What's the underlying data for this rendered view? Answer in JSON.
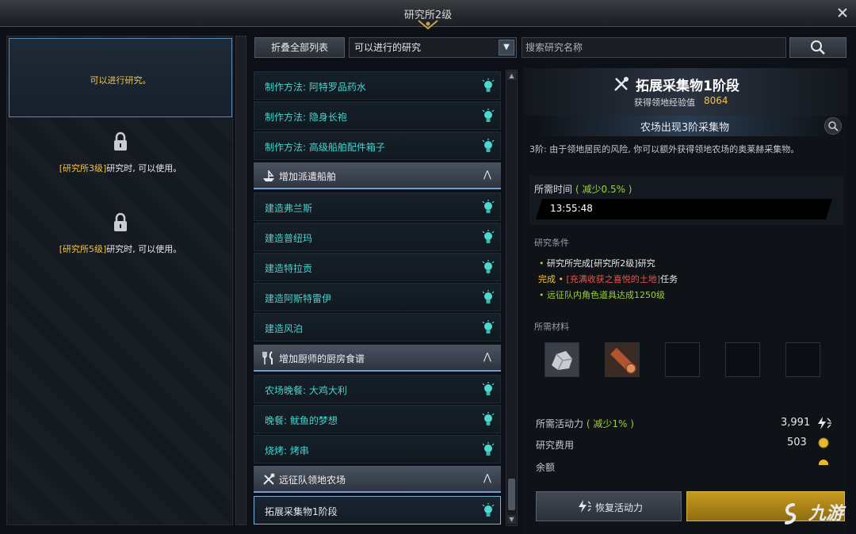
{
  "window": {
    "title": "研究所2级"
  },
  "left_panel": {
    "slots": [
      {
        "text": "可以进行研究。"
      },
      {
        "hl": "[研究所3级]",
        "text": "研究时, 可以使用。"
      },
      {
        "hl": "[研究所5级]",
        "text": "研究时, 可以使用。"
      }
    ]
  },
  "toolbar": {
    "collapse_label": "折叠全部列表",
    "filter_value": "可以进行的研究",
    "search_placeholder": "搜索研究名称"
  },
  "list": {
    "group0_items": [
      "制作方法: 阿特罗品药水",
      "制作方法: 隐身长袍",
      "制作方法: 高级船舶配件箱子"
    ],
    "cat1": "增加派遣船舶",
    "group1_items": [
      "建造弗兰斯",
      "建造普纽玛",
      "建造特拉贡",
      "建造阿斯特雷伊",
      "建造风泊"
    ],
    "cat2": "增加厨师的厨房食谱",
    "group2_items": [
      "农场晚餐: 大鸡大利",
      "晚餐: 鱿鱼的梦想",
      "烧烤: 烤串"
    ],
    "cat3": "远征队领地农场",
    "group3_items": [
      "拓展采集物1阶段"
    ]
  },
  "detail": {
    "title": "拓展采集物1阶段",
    "exp_label": "获得领地经验值",
    "exp_value": "8064",
    "subtitle": "农场出现3阶采集物",
    "description": "3阶: 由于领地居民的风险, 你可以额外获得领地农场的奥莱赫采集物。",
    "time_label": "所需时间",
    "time_reduce": "( 减少0.5% )",
    "time_value": "13:55:48",
    "conditions_label": "研究条件",
    "conditions": [
      {
        "prefix": "•",
        "text": "研究所完成[研究所2级]研究"
      },
      {
        "prefix": "完成 •",
        "text": "[充满收获之喜悦的土地]",
        "suffix": "任务"
      },
      {
        "prefix": "•",
        "text": "远征队内角色道具达成1250级"
      }
    ],
    "materials_label": "所需材料",
    "activity_label": "所需活动力",
    "activity_reduce": "( 减少1% )",
    "activity_value": "3,991",
    "cost_label": "研究费用",
    "cost_value": "503",
    "balance_label": "余额",
    "restore_label": "恢复活动力"
  },
  "watermark": {
    "text": "九游"
  },
  "colors": {
    "accent_gold": "#f0c446",
    "item_cyan": "#46d5cc",
    "reduce_green": "#9bd13b",
    "frame_blue": "#6f9dcf"
  }
}
